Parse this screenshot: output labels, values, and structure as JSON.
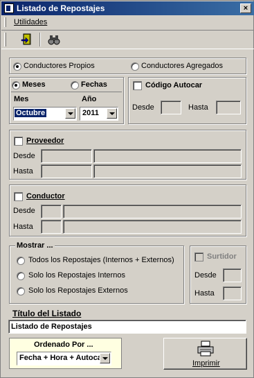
{
  "window": {
    "title": "Listado de Repostajes",
    "close_glyph": "×"
  },
  "menu": {
    "utilidades": "Utilidades"
  },
  "toolbar": {
    "exit_icon": "exit-door-icon",
    "search_icon": "binoculars-icon"
  },
  "conductores": {
    "propios": "Conductores Propios",
    "agregados": "Conductores Agregados",
    "selected": "propios"
  },
  "periodo": {
    "meses": "Meses",
    "fechas": "Fechas",
    "mes_label": "Mes",
    "anio_label": "Año",
    "mes_value": "Octubre",
    "anio_value": "2011"
  },
  "autocar": {
    "label": "Código Autocar",
    "desde": "Desde",
    "hasta": "Hasta"
  },
  "proveedor": {
    "label": "Proveedor",
    "desde": "Desde",
    "hasta": "Hasta"
  },
  "conductor": {
    "label": "Conductor",
    "desde": "Desde",
    "hasta": "Hasta"
  },
  "mostrar": {
    "title": "Mostrar ...",
    "options": [
      "Todos los Repostajes (Internos + Externos)",
      "Solo los Repostajes Internos",
      "Solo los Repostajes Externos"
    ]
  },
  "surtidor": {
    "label": "Surtidor",
    "desde": "Desde",
    "hasta": "Hasta"
  },
  "titulo": {
    "label": "Título del Listado",
    "value": "Listado de Repostajes"
  },
  "ordenado": {
    "label": "Ordenado Por ...",
    "value": "Fecha + Hora + Autoca"
  },
  "imprimir": {
    "label": "Imprimir"
  }
}
